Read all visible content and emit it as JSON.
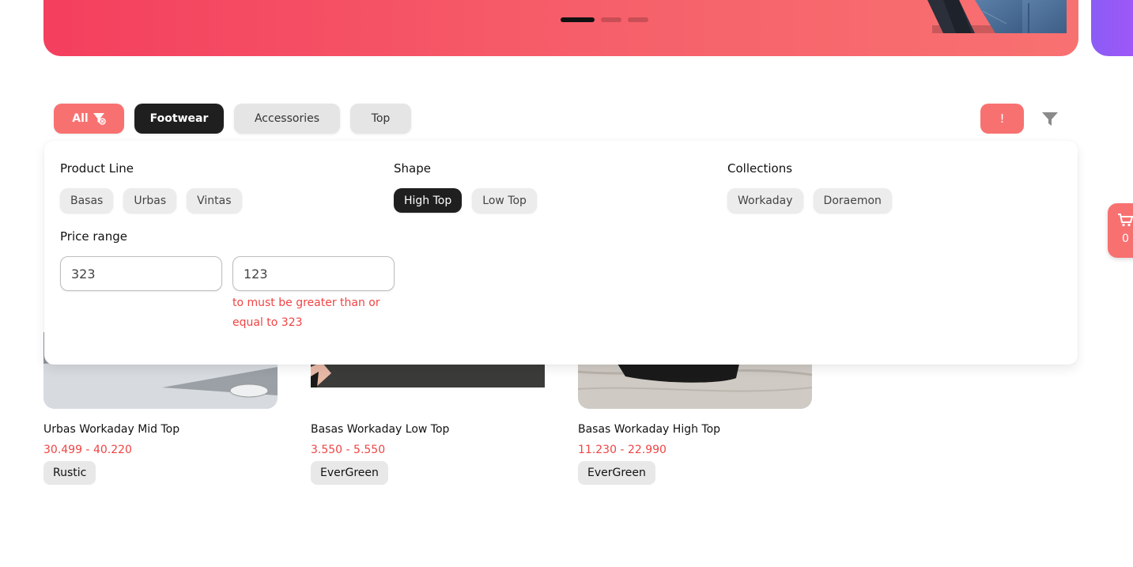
{
  "banner": {
    "dots": [
      true,
      false,
      false
    ],
    "colors": {
      "start": "#f43f5e",
      "end": "#f87171",
      "next_card": "#8b5cf6"
    }
  },
  "categories": [
    {
      "label": "All",
      "icon": "filter-clear-icon",
      "state": "accent"
    },
    {
      "label": "Footwear",
      "state": "selected"
    },
    {
      "label": "Accessories",
      "state": "default"
    },
    {
      "label": "Top",
      "state": "default"
    }
  ],
  "toolbar": {
    "alert_label": "!",
    "filter_icon": "filter-icon"
  },
  "filters": {
    "product_line": {
      "title": "Product Line",
      "options": [
        "Basas",
        "Urbas",
        "Vintas"
      ]
    },
    "shape": {
      "title": "Shape",
      "options": [
        "High Top",
        "Low Top"
      ],
      "selected": "High Top"
    },
    "collections": {
      "title": "Collections",
      "options": [
        "Workaday",
        "Doraemon"
      ]
    },
    "price_range": {
      "title": "Price range",
      "from": "323",
      "to": "123",
      "error": "to must be greater than or equal to 323"
    }
  },
  "cart": {
    "count": "0",
    "icon": "cart-icon"
  },
  "products": [
    {
      "name": "Urbas Workaday Mid Top",
      "price": "30.499 - 40.220",
      "tag": "Rustic"
    },
    {
      "name": "Basas Workaday Low Top",
      "price": "3.550 - 5.550",
      "tag": "EverGreen"
    },
    {
      "name": "Basas Workaday High Top",
      "price": "11.230 - 22.990",
      "tag": "EverGreen"
    }
  ],
  "colors": {
    "accent": "#f87171",
    "selected": "#1f1f1f",
    "error": "#ef4444"
  }
}
